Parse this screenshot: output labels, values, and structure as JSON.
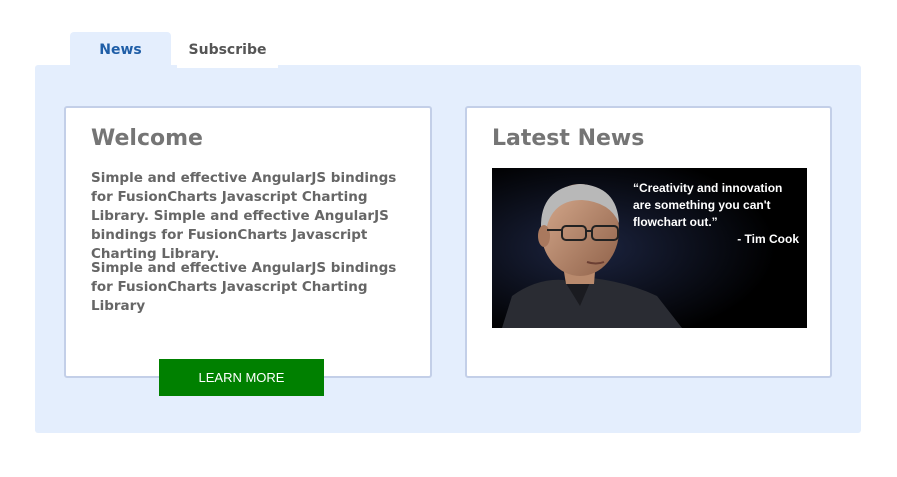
{
  "tabs": [
    {
      "label": "News",
      "active": true
    },
    {
      "label": "Subscribe",
      "active": false
    }
  ],
  "welcome": {
    "title": "Welcome",
    "paragraphs": [
      "Simple and effective AngularJS bindings for FusionCharts Javascript Charting Library. Simple and effective AngularJS bindings for FusionCharts Javascript Charting Library.",
      "Simple and effective AngularJS bindings for FusionCharts Javascript Charting Library"
    ],
    "button_label": "LEARN MORE"
  },
  "news": {
    "title": "Latest News",
    "quote": "“Creativity and innovation are something you can't flowchart out.”",
    "author": "- Tim Cook"
  },
  "colors": {
    "panel_bg": "#e4eefd",
    "active_tab_text": "#1f5ea7",
    "button_bg": "#008000"
  }
}
